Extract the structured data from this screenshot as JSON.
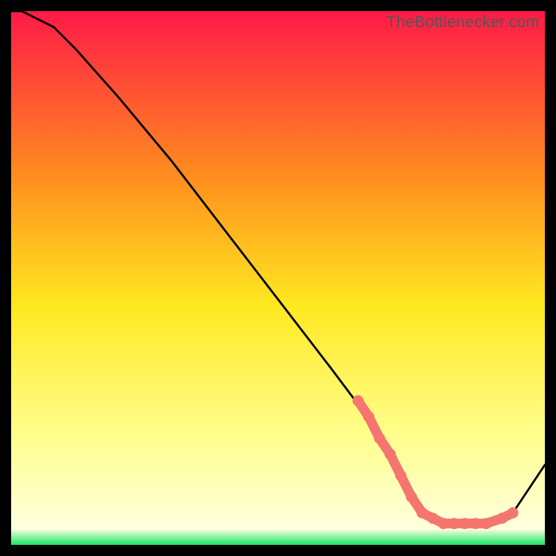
{
  "watermark": "TheBottlenecker.com",
  "chart_data": {
    "type": "line",
    "title": "",
    "xlabel": "",
    "ylabel": "",
    "xlim": [
      0,
      100
    ],
    "ylim": [
      0,
      100
    ],
    "background_gradient": {
      "top": "#ff1a47",
      "mid_upper": "#ff8a1f",
      "mid": "#ffe81f",
      "mid_lower": "#ffff8f",
      "bottom": "#17e864"
    },
    "series": [
      {
        "name": "curve",
        "stroke": "#000000",
        "x": [
          0,
          2,
          4,
          8,
          12,
          20,
          30,
          40,
          50,
          60,
          66,
          70,
          74,
          78,
          82,
          86,
          90,
          94,
          100
        ],
        "y": [
          100,
          100,
          99,
          97,
          93,
          84,
          72,
          59,
          46,
          33,
          25,
          19,
          11,
          6,
          4,
          4,
          4,
          6,
          15
        ]
      }
    ],
    "markers": {
      "name": "highlighted-points",
      "fill": "#f4766f",
      "x": [
        65,
        67,
        69,
        71,
        73,
        75,
        77,
        79,
        81,
        83,
        85,
        87,
        89,
        92,
        94
      ],
      "y": [
        27,
        24,
        20,
        17,
        13,
        9,
        6,
        5,
        4,
        4,
        4,
        4,
        4,
        5,
        6
      ]
    }
  }
}
